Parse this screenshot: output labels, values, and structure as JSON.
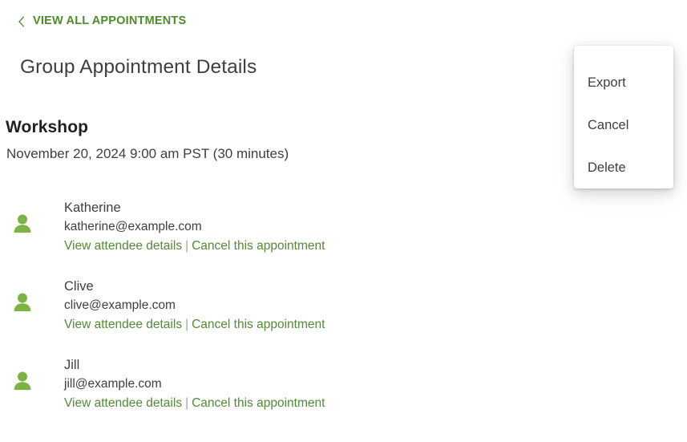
{
  "back": {
    "label": "VIEW ALL APPOINTMENTS",
    "icon": "chevron-left-icon"
  },
  "page_title": "Group Appointment Details",
  "appointment": {
    "name": "Workshop",
    "when": "November 20, 2024 9:00 am PST (30 minutes)"
  },
  "attendees": [
    {
      "icon": "person-icon",
      "name": "Katherine",
      "email": "katherine@example.com",
      "view_details_label": "View attendee details",
      "separator": "|",
      "cancel_label": "Cancel this appointment"
    },
    {
      "icon": "person-icon",
      "name": "Clive",
      "email": "clive@example.com",
      "view_details_label": "View attendee details",
      "separator": "|",
      "cancel_label": "Cancel this appointment"
    },
    {
      "icon": "person-icon",
      "name": "Jill",
      "email": "jill@example.com",
      "view_details_label": "View attendee details",
      "separator": "|",
      "cancel_label": "Cancel this appointment"
    }
  ],
  "menu": {
    "items": [
      {
        "label": "Export"
      },
      {
        "label": "Cancel"
      },
      {
        "label": "Delete"
      }
    ]
  },
  "colors": {
    "link_green": "#528A36",
    "back_green": "#4E8B2C",
    "icon_green": "#7CB342",
    "text_dark": "#3c4043",
    "heading_dark": "#202124",
    "separator_gray": "#9aa69a",
    "background": "#ffffff"
  }
}
